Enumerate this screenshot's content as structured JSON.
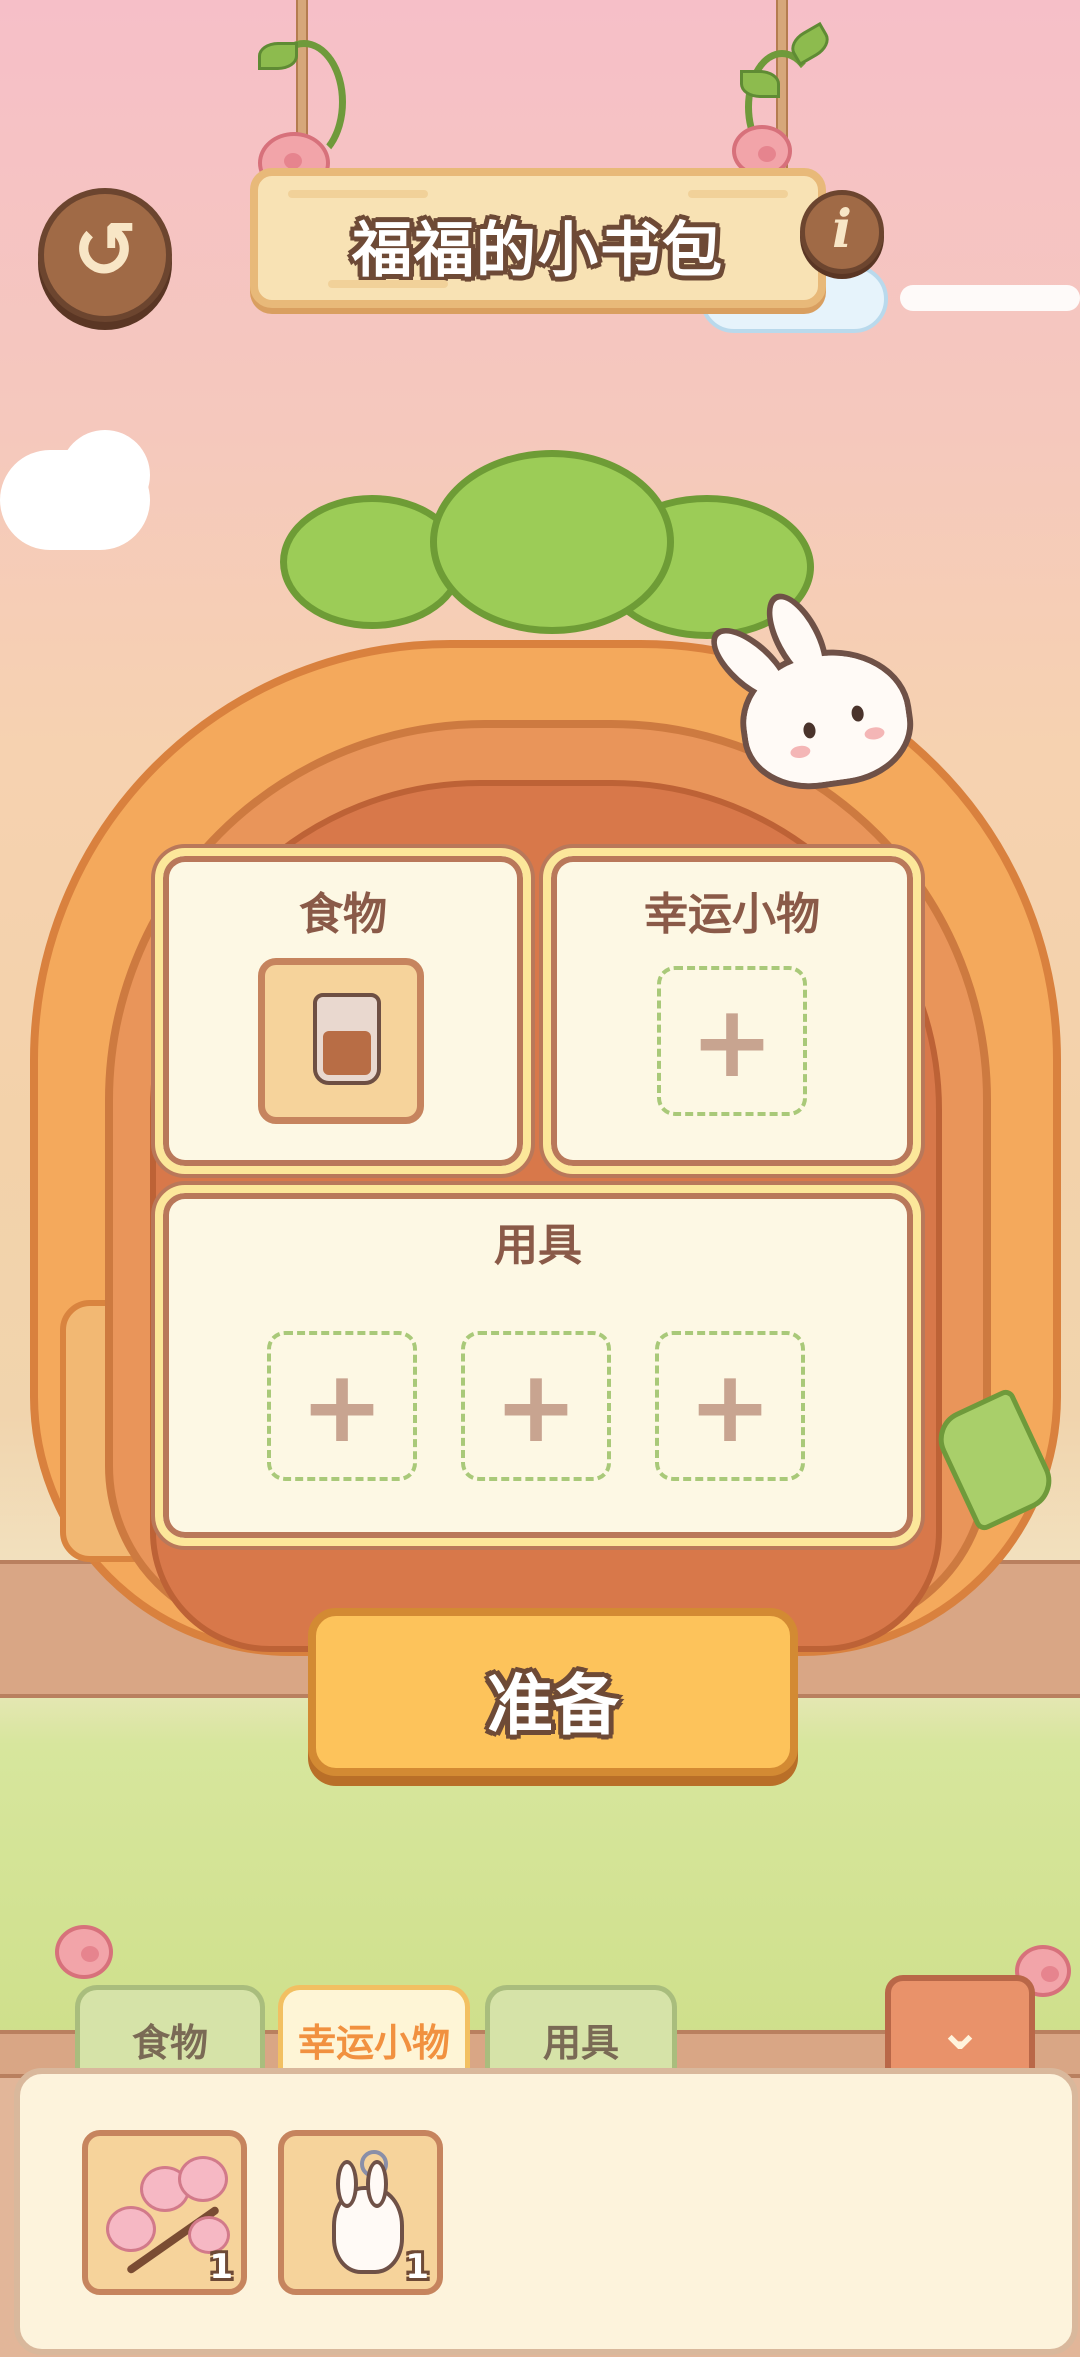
{
  "header": {
    "title": "福福的小书包",
    "back_icon": "back-arrow-icon",
    "info_icon": "info-icon",
    "info_glyph": "i"
  },
  "backpack": {
    "slots": {
      "food": {
        "label": "食物",
        "item": "iced-drink-cup"
      },
      "lucky": {
        "label": "幸运小物",
        "placeholder": "+"
      },
      "tools": {
        "label": "用具",
        "placeholders": [
          "+",
          "+",
          "+"
        ]
      }
    }
  },
  "ready_button": {
    "label": "准备"
  },
  "tabs": [
    {
      "label": "食物",
      "active": false
    },
    {
      "label": "幸运小物",
      "active": true
    },
    {
      "label": "用具",
      "active": false
    }
  ],
  "collapse_icon": "chevron-down-icon",
  "inventory": [
    {
      "icon": "cherry-blossom-branch",
      "count": "1"
    },
    {
      "icon": "bunny-keychain",
      "count": "1"
    }
  ],
  "colors": {
    "accent": "#f19140",
    "button": "#fdc35b",
    "outline": "#6e4a36"
  }
}
